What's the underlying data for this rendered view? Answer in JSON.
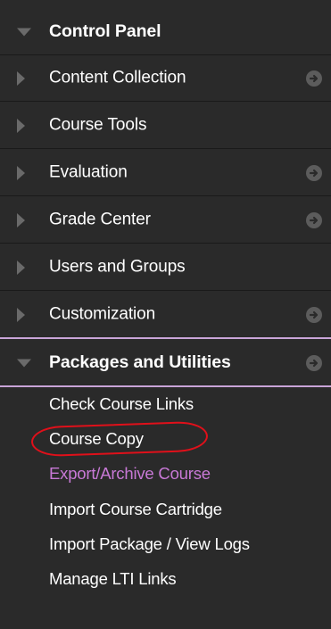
{
  "menu": {
    "header_label": "Control Panel",
    "items": [
      {
        "label": "Content Collection",
        "has_arrow": true
      },
      {
        "label": "Course Tools",
        "has_arrow": false
      },
      {
        "label": "Evaluation",
        "has_arrow": true
      },
      {
        "label": "Grade Center",
        "has_arrow": true
      },
      {
        "label": "Users and Groups",
        "has_arrow": false
      },
      {
        "label": "Customization",
        "has_arrow": true
      }
    ],
    "expanded": {
      "label": "Packages and Utilities",
      "subitems": [
        {
          "label": "Check Course Links"
        },
        {
          "label": "Course Copy"
        },
        {
          "label": "Export/Archive Course"
        },
        {
          "label": "Import Course Cartridge"
        },
        {
          "label": "Import Package / View Logs"
        },
        {
          "label": "Manage LTI Links"
        }
      ]
    }
  },
  "colors": {
    "background": "#2a2a2a",
    "text": "#ffffff",
    "active_link": "#c879d6",
    "selection_line": "#c9a4d8",
    "annotation": "#e0101a"
  }
}
